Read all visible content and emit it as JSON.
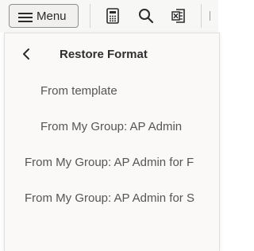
{
  "toolbar": {
    "menu_label": "Menu",
    "icons": [
      "calculator-icon",
      "search-icon",
      "excel-export-icon"
    ]
  },
  "panel": {
    "title": "Restore Format",
    "back_icon": "chevron-left-icon",
    "items": [
      {
        "label": "From template"
      },
      {
        "label": "From My Group: AP Admin"
      },
      {
        "label": "From My Group: AP Admin for F"
      },
      {
        "label": "From My Group: AP Admin for S"
      }
    ]
  },
  "colors": {
    "toolbar_bg": "#f7f7f6",
    "panel_bg": "#fbf9f8",
    "text_primary": "#2f2f2f",
    "text_secondary": "#555555"
  }
}
